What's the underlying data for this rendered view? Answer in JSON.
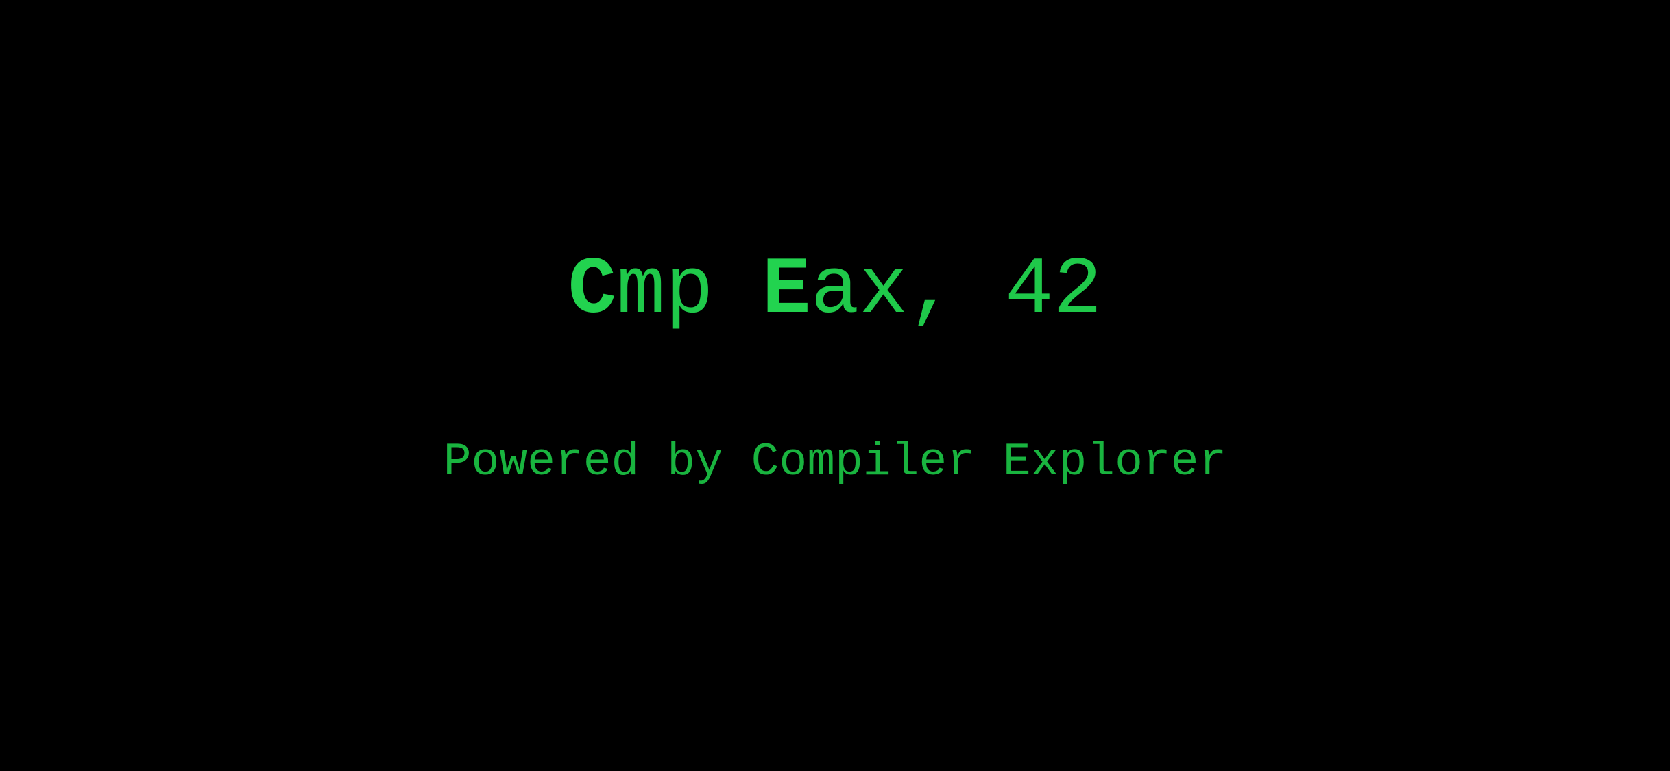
{
  "title": {
    "part1_initial": "C",
    "part1_rest": "mp ",
    "part2_initial": "E",
    "part2_rest": "ax, 42"
  },
  "subtitle": "Powered by Compiler Explorer",
  "colors": {
    "background": "#000000",
    "accent_green": "#22d34f",
    "text_green": "#1fc94a",
    "subtitle_green": "#19b43f"
  }
}
